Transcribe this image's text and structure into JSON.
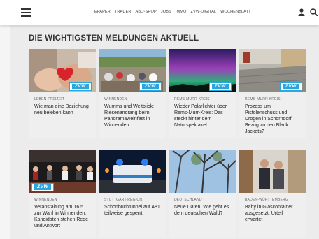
{
  "nav": {
    "items": [
      "EPAPER",
      "TRAUER",
      "ABO-SHOP",
      "JOBS",
      "IMMO",
      "ZVW-DIGITAL",
      "WOCHENBLATT"
    ]
  },
  "icons": {
    "menu": "hamburger-menu-icon",
    "user": "user-icon",
    "search": "search-icon"
  },
  "section": {
    "heading": "DIE WICHTIGSTEN MELDUNGEN AKTUELL"
  },
  "badge_label": "ZVW",
  "colors": {
    "badge": "#2aa6df",
    "card_bg": "#efefef"
  },
  "articles": [
    {
      "kicker": "LEBEN-FREIZEIT",
      "title": "Wie man eine Beziehung neu beleben kann",
      "badge": true
    },
    {
      "kicker": "WINNENDEN",
      "title": "Wumms und Weitblick: Riesenandrang beim Panoramaweinfest in Winnenden",
      "badge": true
    },
    {
      "kicker": "REMS-MURR-KREIS",
      "title": "Wieder Polarlichter über Rems-Murr-Kreis: Das steckt hinter dem Naturspektakel",
      "badge": true
    },
    {
      "kicker": "REMS-MURR-KREIS",
      "title": "Prozess um Pistolenschuss und Drogen in Schorndorf: Bezug zu den Black Jackets?",
      "badge": true
    },
    {
      "kicker": "WINNENDEN",
      "title": "Veranstaltung am 16.5. zur Wahl in Winnenden: Kandidaten stehen Rede und Antwort",
      "badge": true
    },
    {
      "kicker": "STUTTGART-REGION",
      "title": "Schönbuchtunnel auf A81 teilweise gesperrt",
      "badge": false
    },
    {
      "kicker": "DEUTSCHLAND",
      "title": "Neue Daten: Wie geht es dem deutschen Wald?",
      "badge": false
    },
    {
      "kicker": "BADEN-WÜRTTEMBERG",
      "title": "Baby in Glascontainer ausgesetzt: Urteil erwartet",
      "badge": false
    }
  ]
}
